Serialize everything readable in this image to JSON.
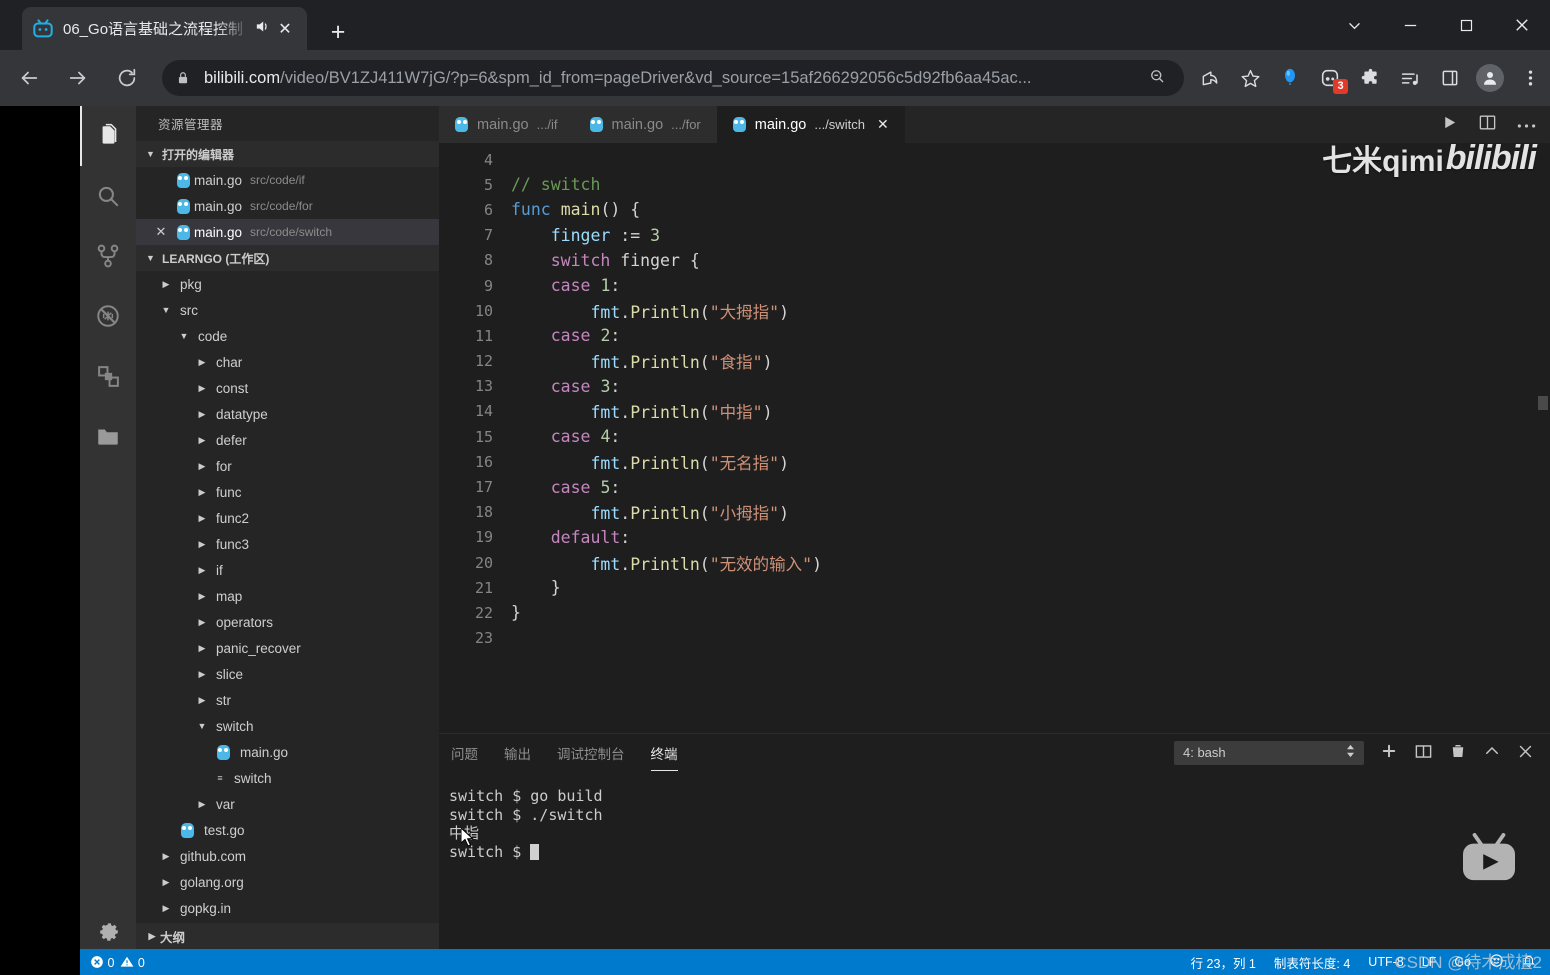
{
  "browser": {
    "tab": {
      "title": "06_Go语言基础之流程控制",
      "favicon": "bilibili-icon",
      "audio_icon": "speaker-icon",
      "close_icon": "close-icon"
    },
    "newtab_label": "+",
    "window_controls": [
      "chevron-down-icon",
      "minimize-icon",
      "maximize-icon",
      "close-icon"
    ],
    "nav": {
      "back": "back-arrow-icon",
      "forward": "forward-arrow-icon",
      "reload": "reload-icon"
    },
    "url": {
      "domain": "bilibili.com",
      "path": "/video/BV1ZJ411W7jG/?p=6&spm_id_from=pageDriver&vd_source=15af266292056c5d92fb6aa45ac..."
    },
    "toolbar_icons": [
      "zoom-out-icon",
      "share-icon",
      "bookmark-star-icon",
      "balloon-icon",
      "extension-badge-icon",
      "puzzle-extensions-icon",
      "media-list-icon",
      "sidepanel-icon",
      "profile-avatar-icon",
      "more-menu-icon"
    ],
    "extension_badge_count": "3"
  },
  "vscode": {
    "activitybar": [
      {
        "name": "explorer-icon",
        "active": true
      },
      {
        "name": "search-icon",
        "active": false
      },
      {
        "name": "source-control-icon",
        "active": false
      },
      {
        "name": "run-debug-disabled-icon",
        "active": false
      },
      {
        "name": "extensions-icon",
        "active": false
      },
      {
        "name": "remote-folder-icon",
        "active": false
      },
      {
        "name": "settings-gear-icon",
        "active": false
      }
    ],
    "sidebar": {
      "title": "资源管理器",
      "open_editors": {
        "label": "打开的编辑器",
        "items": [
          {
            "name": "main.go",
            "path": "src/code/if",
            "selected": false,
            "closeable": false
          },
          {
            "name": "main.go",
            "path": "src/code/for",
            "selected": false,
            "closeable": false
          },
          {
            "name": "main.go",
            "path": "src/code/switch",
            "selected": true,
            "closeable": true
          }
        ]
      },
      "workspace": {
        "label": "LEARNGO (工作区)"
      },
      "tree": [
        {
          "label": "pkg",
          "depth": 1,
          "type": "folder",
          "expanded": false
        },
        {
          "label": "src",
          "depth": 1,
          "type": "folder",
          "expanded": true
        },
        {
          "label": "code",
          "depth": 2,
          "type": "folder",
          "expanded": true
        },
        {
          "label": "char",
          "depth": 3,
          "type": "folder",
          "expanded": false
        },
        {
          "label": "const",
          "depth": 3,
          "type": "folder",
          "expanded": false
        },
        {
          "label": "datatype",
          "depth": 3,
          "type": "folder",
          "expanded": false
        },
        {
          "label": "defer",
          "depth": 3,
          "type": "folder",
          "expanded": false
        },
        {
          "label": "for",
          "depth": 3,
          "type": "folder",
          "expanded": false
        },
        {
          "label": "func",
          "depth": 3,
          "type": "folder",
          "expanded": false
        },
        {
          "label": "func2",
          "depth": 3,
          "type": "folder",
          "expanded": false
        },
        {
          "label": "func3",
          "depth": 3,
          "type": "folder",
          "expanded": false
        },
        {
          "label": "if",
          "depth": 3,
          "type": "folder",
          "expanded": false
        },
        {
          "label": "map",
          "depth": 3,
          "type": "folder",
          "expanded": false
        },
        {
          "label": "operators",
          "depth": 3,
          "type": "folder",
          "expanded": false
        },
        {
          "label": "panic_recover",
          "depth": 3,
          "type": "folder",
          "expanded": false
        },
        {
          "label": "slice",
          "depth": 3,
          "type": "folder",
          "expanded": false
        },
        {
          "label": "str",
          "depth": 3,
          "type": "folder",
          "expanded": false
        },
        {
          "label": "switch",
          "depth": 3,
          "type": "folder",
          "expanded": true
        },
        {
          "label": "main.go",
          "depth": 4,
          "type": "gofile"
        },
        {
          "label": "switch",
          "depth": 4,
          "type": "binary"
        },
        {
          "label": "var",
          "depth": 3,
          "type": "folder",
          "expanded": false
        },
        {
          "label": "test.go",
          "depth": 2,
          "type": "gofile"
        },
        {
          "label": "github.com",
          "depth": 1,
          "type": "folder",
          "expanded": false
        },
        {
          "label": "golang.org",
          "depth": 1,
          "type": "folder",
          "expanded": false
        },
        {
          "label": "gopkg.in",
          "depth": 1,
          "type": "folder",
          "expanded": false
        }
      ],
      "outline_label": "大纲"
    },
    "editor": {
      "tabs": [
        {
          "name": "main.go",
          "sub": ".../if",
          "active": false,
          "closeable": false
        },
        {
          "name": "main.go",
          "sub": ".../for",
          "active": false,
          "closeable": false
        },
        {
          "name": "main.go",
          "sub": ".../switch",
          "active": true,
          "closeable": true
        }
      ],
      "actions": [
        "run-play-icon",
        "split-editor-icon",
        "more-actions-icon"
      ],
      "lines": [
        {
          "n": "4",
          "tokens": []
        },
        {
          "n": "5",
          "tokens": [
            {
              "t": "// switch",
              "c": "k-comment"
            }
          ]
        },
        {
          "n": "6",
          "tokens": [
            {
              "t": "func",
              "c": "k-kw"
            },
            {
              "t": " ",
              "c": "k-pl"
            },
            {
              "t": "main",
              "c": "k-fn"
            },
            {
              "t": "() {",
              "c": "k-pl"
            }
          ]
        },
        {
          "n": "7",
          "tokens": [
            {
              "t": "    ",
              "c": "k-pl"
            },
            {
              "t": "finger",
              "c": "k-var"
            },
            {
              "t": " := ",
              "c": "k-pl"
            },
            {
              "t": "3",
              "c": "k-num"
            }
          ]
        },
        {
          "n": "8",
          "tokens": [
            {
              "t": "    ",
              "c": "k-pl"
            },
            {
              "t": "switch",
              "c": "k-kw2"
            },
            {
              "t": " finger {",
              "c": "k-pl"
            }
          ]
        },
        {
          "n": "9",
          "tokens": [
            {
              "t": "    ",
              "c": "k-pl"
            },
            {
              "t": "case",
              "c": "k-kw2"
            },
            {
              "t": " ",
              "c": "k-pl"
            },
            {
              "t": "1",
              "c": "k-num"
            },
            {
              "t": ":",
              "c": "k-pl"
            }
          ]
        },
        {
          "n": "10",
          "tokens": [
            {
              "t": "        ",
              "c": "k-pl"
            },
            {
              "t": "fmt",
              "c": "k-var"
            },
            {
              "t": ".",
              "c": "k-pl"
            },
            {
              "t": "Println",
              "c": "k-fn"
            },
            {
              "t": "(",
              "c": "k-pl"
            },
            {
              "t": "\"大拇指\"",
              "c": "k-str"
            },
            {
              "t": ")",
              "c": "k-pl"
            }
          ]
        },
        {
          "n": "11",
          "tokens": [
            {
              "t": "    ",
              "c": "k-pl"
            },
            {
              "t": "case",
              "c": "k-kw2"
            },
            {
              "t": " ",
              "c": "k-pl"
            },
            {
              "t": "2",
              "c": "k-num"
            },
            {
              "t": ":",
              "c": "k-pl"
            }
          ]
        },
        {
          "n": "12",
          "tokens": [
            {
              "t": "        ",
              "c": "k-pl"
            },
            {
              "t": "fmt",
              "c": "k-var"
            },
            {
              "t": ".",
              "c": "k-pl"
            },
            {
              "t": "Println",
              "c": "k-fn"
            },
            {
              "t": "(",
              "c": "k-pl"
            },
            {
              "t": "\"食指\"",
              "c": "k-str"
            },
            {
              "t": ")",
              "c": "k-pl"
            }
          ]
        },
        {
          "n": "13",
          "tokens": [
            {
              "t": "    ",
              "c": "k-pl"
            },
            {
              "t": "case",
              "c": "k-kw2"
            },
            {
              "t": " ",
              "c": "k-pl"
            },
            {
              "t": "3",
              "c": "k-num"
            },
            {
              "t": ":",
              "c": "k-pl"
            }
          ]
        },
        {
          "n": "14",
          "tokens": [
            {
              "t": "        ",
              "c": "k-pl"
            },
            {
              "t": "fmt",
              "c": "k-var"
            },
            {
              "t": ".",
              "c": "k-pl"
            },
            {
              "t": "Println",
              "c": "k-fn"
            },
            {
              "t": "(",
              "c": "k-pl"
            },
            {
              "t": "\"中指\"",
              "c": "k-str"
            },
            {
              "t": ")",
              "c": "k-pl"
            }
          ]
        },
        {
          "n": "15",
          "tokens": [
            {
              "t": "    ",
              "c": "k-pl"
            },
            {
              "t": "case",
              "c": "k-kw2"
            },
            {
              "t": " ",
              "c": "k-pl"
            },
            {
              "t": "4",
              "c": "k-num"
            },
            {
              "t": ":",
              "c": "k-pl"
            }
          ]
        },
        {
          "n": "16",
          "tokens": [
            {
              "t": "        ",
              "c": "k-pl"
            },
            {
              "t": "fmt",
              "c": "k-var"
            },
            {
              "t": ".",
              "c": "k-pl"
            },
            {
              "t": "Println",
              "c": "k-fn"
            },
            {
              "t": "(",
              "c": "k-pl"
            },
            {
              "t": "\"无名指\"",
              "c": "k-str"
            },
            {
              "t": ")",
              "c": "k-pl"
            }
          ]
        },
        {
          "n": "17",
          "tokens": [
            {
              "t": "    ",
              "c": "k-pl"
            },
            {
              "t": "case",
              "c": "k-kw2"
            },
            {
              "t": " ",
              "c": "k-pl"
            },
            {
              "t": "5",
              "c": "k-num"
            },
            {
              "t": ":",
              "c": "k-pl"
            }
          ]
        },
        {
          "n": "18",
          "tokens": [
            {
              "t": "        ",
              "c": "k-pl"
            },
            {
              "t": "fmt",
              "c": "k-var"
            },
            {
              "t": ".",
              "c": "k-pl"
            },
            {
              "t": "Println",
              "c": "k-fn"
            },
            {
              "t": "(",
              "c": "k-pl"
            },
            {
              "t": "\"小拇指\"",
              "c": "k-str"
            },
            {
              "t": ")",
              "c": "k-pl"
            }
          ]
        },
        {
          "n": "19",
          "tokens": [
            {
              "t": "    ",
              "c": "k-pl"
            },
            {
              "t": "default",
              "c": "k-kw2"
            },
            {
              "t": ":",
              "c": "k-pl"
            }
          ]
        },
        {
          "n": "20",
          "tokens": [
            {
              "t": "        ",
              "c": "k-pl"
            },
            {
              "t": "fmt",
              "c": "k-var"
            },
            {
              "t": ".",
              "c": "k-pl"
            },
            {
              "t": "Println",
              "c": "k-fn"
            },
            {
              "t": "(",
              "c": "k-pl"
            },
            {
              "t": "\"无效的输入\"",
              "c": "k-str"
            },
            {
              "t": ")",
              "c": "k-pl"
            }
          ]
        },
        {
          "n": "21",
          "tokens": [
            {
              "t": "    }",
              "c": "k-pl"
            }
          ]
        },
        {
          "n": "22",
          "tokens": [
            {
              "t": "}",
              "c": "k-pl"
            }
          ]
        },
        {
          "n": "23",
          "tokens": []
        }
      ]
    },
    "panel": {
      "tabs": [
        {
          "label": "问题",
          "active": false
        },
        {
          "label": "输出",
          "active": false
        },
        {
          "label": "调试控制台",
          "active": false
        },
        {
          "label": "终端",
          "active": true
        }
      ],
      "terminal_select": "4: bash",
      "actions": [
        "new-terminal-icon",
        "split-terminal-icon",
        "kill-terminal-icon",
        "maximize-panel-icon",
        "close-panel-icon"
      ],
      "terminal_lines": [
        "switch $ go build",
        "switch $ ./switch",
        "中指",
        "switch $ "
      ]
    },
    "statusbar": {
      "errors": "0",
      "warnings": "0",
      "position": "行 23，列 1",
      "tabsize": "制表符长度: 4",
      "encoding": "UTF-8",
      "eol": "LF",
      "language": "Go",
      "icons": [
        "feedback-smiley-icon",
        "bell-icon"
      ]
    }
  },
  "watermarks": {
    "uploader": "七米qimi",
    "site_logo": "bilibili",
    "tv_icon": "bilibili-tv-icon",
    "csdn": "CSDN @待木成植2"
  },
  "colors": {
    "accent_blue": "#007acc",
    "browser_bg": "#202124",
    "editor_bg": "#1e1e1e",
    "sidebar_bg": "#252526",
    "activitybar_bg": "#333333",
    "badge_red": "#e23a29",
    "gopher_blue": "#4bb8e8"
  }
}
